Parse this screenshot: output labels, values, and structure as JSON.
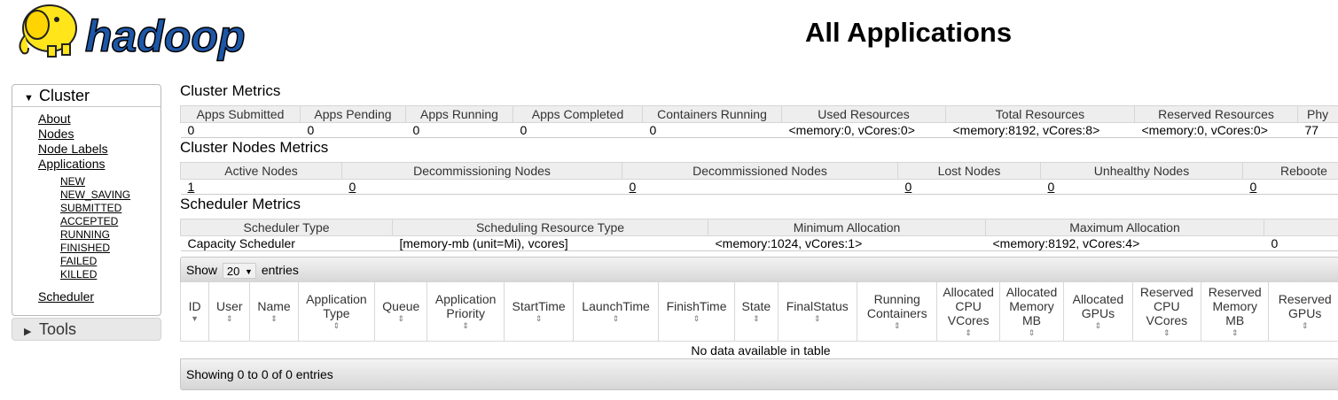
{
  "header": {
    "logo_text": "hadoop",
    "title": "All Applications"
  },
  "nav": {
    "cluster_label": "Cluster",
    "cluster_items": [
      "About",
      "Nodes",
      "Node Labels",
      "Applications"
    ],
    "app_states": [
      "NEW",
      "NEW_SAVING",
      "SUBMITTED",
      "ACCEPTED",
      "RUNNING",
      "FINISHED",
      "FAILED",
      "KILLED"
    ],
    "scheduler_label": "Scheduler",
    "tools_label": "Tools"
  },
  "cluster_metrics": {
    "title": "Cluster Metrics",
    "headers": [
      "Apps Submitted",
      "Apps Pending",
      "Apps Running",
      "Apps Completed",
      "Containers Running",
      "Used Resources",
      "Total Resources",
      "Reserved Resources",
      "Phy"
    ],
    "values": [
      "0",
      "0",
      "0",
      "0",
      "0",
      "<memory:0, vCores:0>",
      "<memory:8192, vCores:8>",
      "<memory:0, vCores:0>",
      "77"
    ]
  },
  "cluster_nodes_metrics": {
    "title": "Cluster Nodes Metrics",
    "headers": [
      "Active Nodes",
      "Decommissioning Nodes",
      "Decommissioned Nodes",
      "Lost Nodes",
      "Unhealthy Nodes",
      "Reboote"
    ],
    "values": [
      "1",
      "0",
      "0",
      "0",
      "0",
      "0"
    ]
  },
  "scheduler_metrics": {
    "title": "Scheduler Metrics",
    "headers": [
      "Scheduler Type",
      "Scheduling Resource Type",
      "Minimum Allocation",
      "Maximum Allocation",
      ""
    ],
    "values": [
      "Capacity Scheduler",
      "[memory-mb (unit=Mi), vcores]",
      "<memory:1024, vCores:1>",
      "<memory:8192, vCores:4>",
      "0"
    ]
  },
  "apps_table": {
    "show_label": "Show",
    "page_length": "20",
    "entries_label": "entries",
    "columns": [
      "ID",
      "User",
      "Name",
      "Application Type",
      "Queue",
      "Application Priority",
      "StartTime",
      "LaunchTime",
      "FinishTime",
      "State",
      "FinalStatus",
      "Running Containers",
      "Allocated CPU VCores",
      "Allocated Memory MB",
      "Allocated GPUs",
      "Reserved CPU VCores",
      "Reserved Memory MB",
      "Reserved GPUs"
    ],
    "empty_message": "No data available in table",
    "info": "Showing 0 to 0 of 0 entries"
  }
}
